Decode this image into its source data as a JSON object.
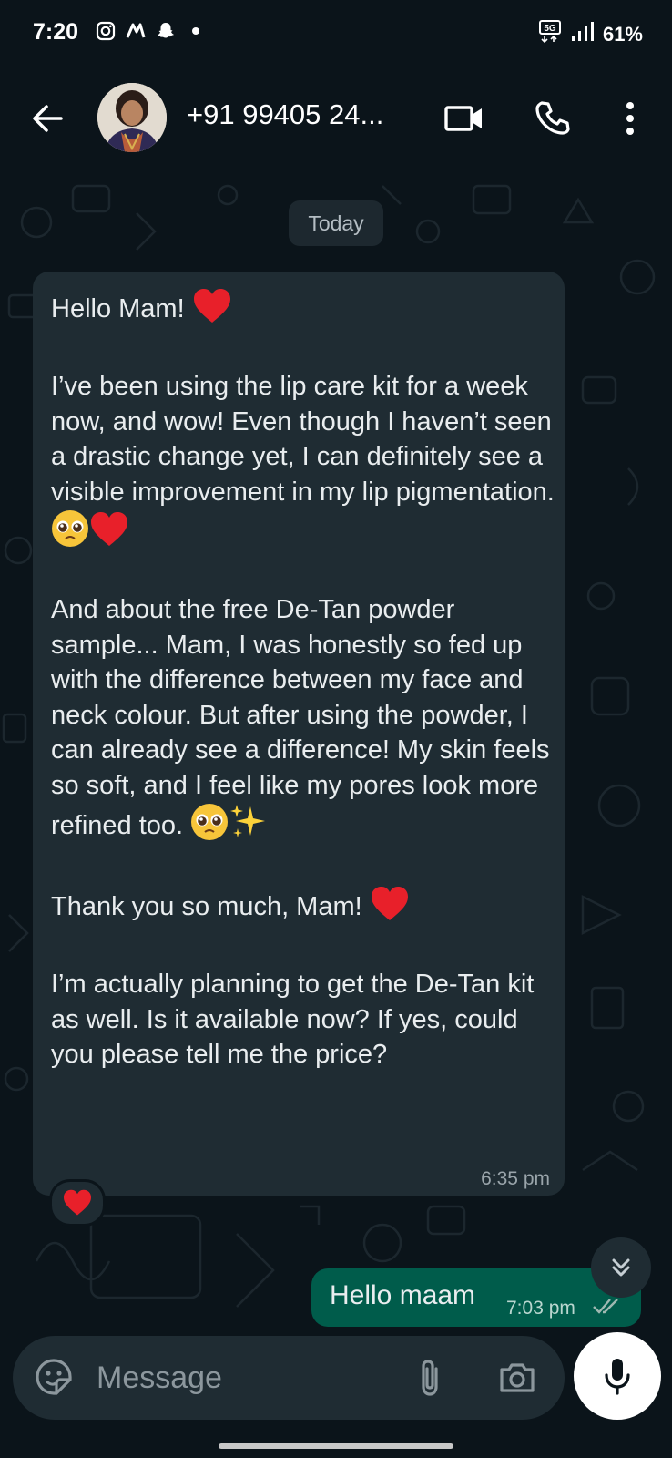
{
  "status_bar": {
    "time": "7:20",
    "battery": "61%",
    "network": "5G"
  },
  "header": {
    "contact_name": "+91 99405 24..."
  },
  "chat": {
    "date_chip": "Today",
    "incoming": {
      "paragraphs": [
        "Hello Mam! ",
        "I’ve been using the lip care kit for a week now, and wow! Even though I haven’t seen a drastic change yet, I can definitely see a visible improvement in my lip pigmentation.",
        "And about the free De-Tan powder sample... Mam, I was honestly so fed up with the difference between my face and neck colour. But after using the powder, I can already see a difference! My skin feels so soft, and I feel like my pores look more refined too. ",
        "Thank you so much, Mam! ",
        "I’m actually planning to get the De-Tan kit as well. Is it available now? If yes, could you please tell me the price?"
      ],
      "time": "6:35 pm",
      "reaction": "heart"
    },
    "outgoing": {
      "text": "Hello maam",
      "time": "7:03 pm",
      "status": "delivered"
    }
  },
  "input": {
    "placeholder": "Message"
  },
  "icons": {
    "back": "arrow-left-icon",
    "video": "video-call-icon",
    "call": "phone-icon",
    "menu": "more-vert-icon",
    "emoji": "sticker-icon",
    "attach": "paperclip-icon",
    "camera": "camera-icon",
    "mic": "mic-icon"
  },
  "colors": {
    "background": "#0b141a",
    "incoming_bubble": "#1f2c33",
    "outgoing_bubble": "#005c4b"
  }
}
